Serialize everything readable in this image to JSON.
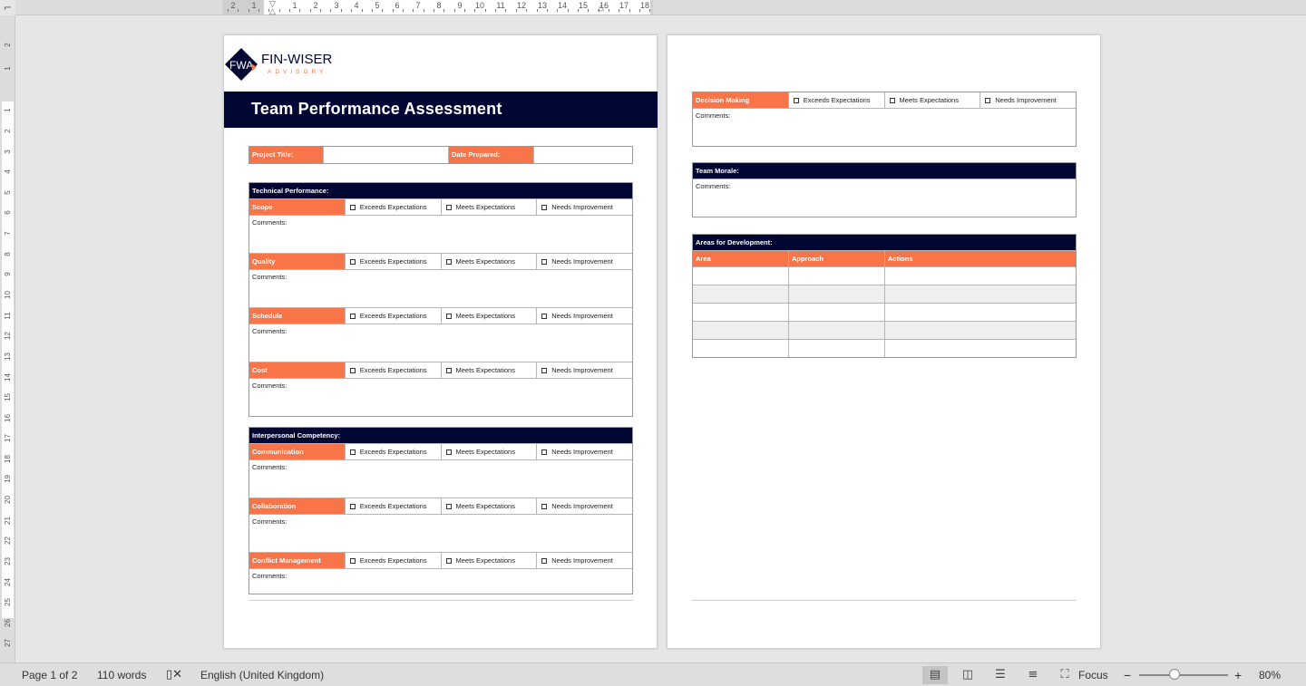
{
  "ruler": {
    "corner_icon": "⌐",
    "labels": [
      "2",
      "1",
      "1",
      "2",
      "3",
      "4",
      "5",
      "6",
      "7",
      "8",
      "9",
      "10",
      "11",
      "12",
      "13",
      "14",
      "15",
      "16",
      "17",
      "18"
    ],
    "vlabels": [
      "2",
      "1",
      "1",
      "2",
      "3",
      "4",
      "5",
      "6",
      "7",
      "8",
      "9",
      "10",
      "11",
      "12",
      "13",
      "14",
      "15",
      "16",
      "17",
      "18",
      "19",
      "20",
      "21",
      "22",
      "23",
      "24",
      "25",
      "26",
      "27"
    ]
  },
  "logo": {
    "monogram": "FWA",
    "name": "FIN-WISER",
    "tagline": "ADVISORY",
    "colors": {
      "navy": "#020633",
      "orange": "#f77548"
    }
  },
  "page1": {
    "title": "Team Performance Assessment",
    "project_title_label": "Project Title:",
    "date_prepared_label": "Date Prepared:",
    "technical": {
      "heading": "Technical Performance:",
      "criteria": [
        "Scope",
        "Quality",
        "Schedule",
        "Cost"
      ]
    },
    "interpersonal": {
      "heading": "Interpersonal Competency:",
      "criteria": [
        "Communication",
        "Collaboration",
        "Conflict Management"
      ]
    }
  },
  "options": {
    "exceeds": "Exceeds Expectations",
    "meets": "Meets Expectations",
    "needs": "Needs Improvement"
  },
  "comments_label": "Comments:",
  "page2": {
    "decision_label": "Decision Making",
    "team_morale_heading": "Team Morale:",
    "development": {
      "heading": "Areas for Development:",
      "columns": [
        "Area",
        "Approach",
        "Actions"
      ]
    }
  },
  "status_bar": {
    "page": "Page 1 of 2",
    "words": "110 words",
    "language": "English (United Kingdom)",
    "focus": "Focus",
    "zoom": "80%",
    "zoom_minus": "−",
    "zoom_plus": "+"
  }
}
